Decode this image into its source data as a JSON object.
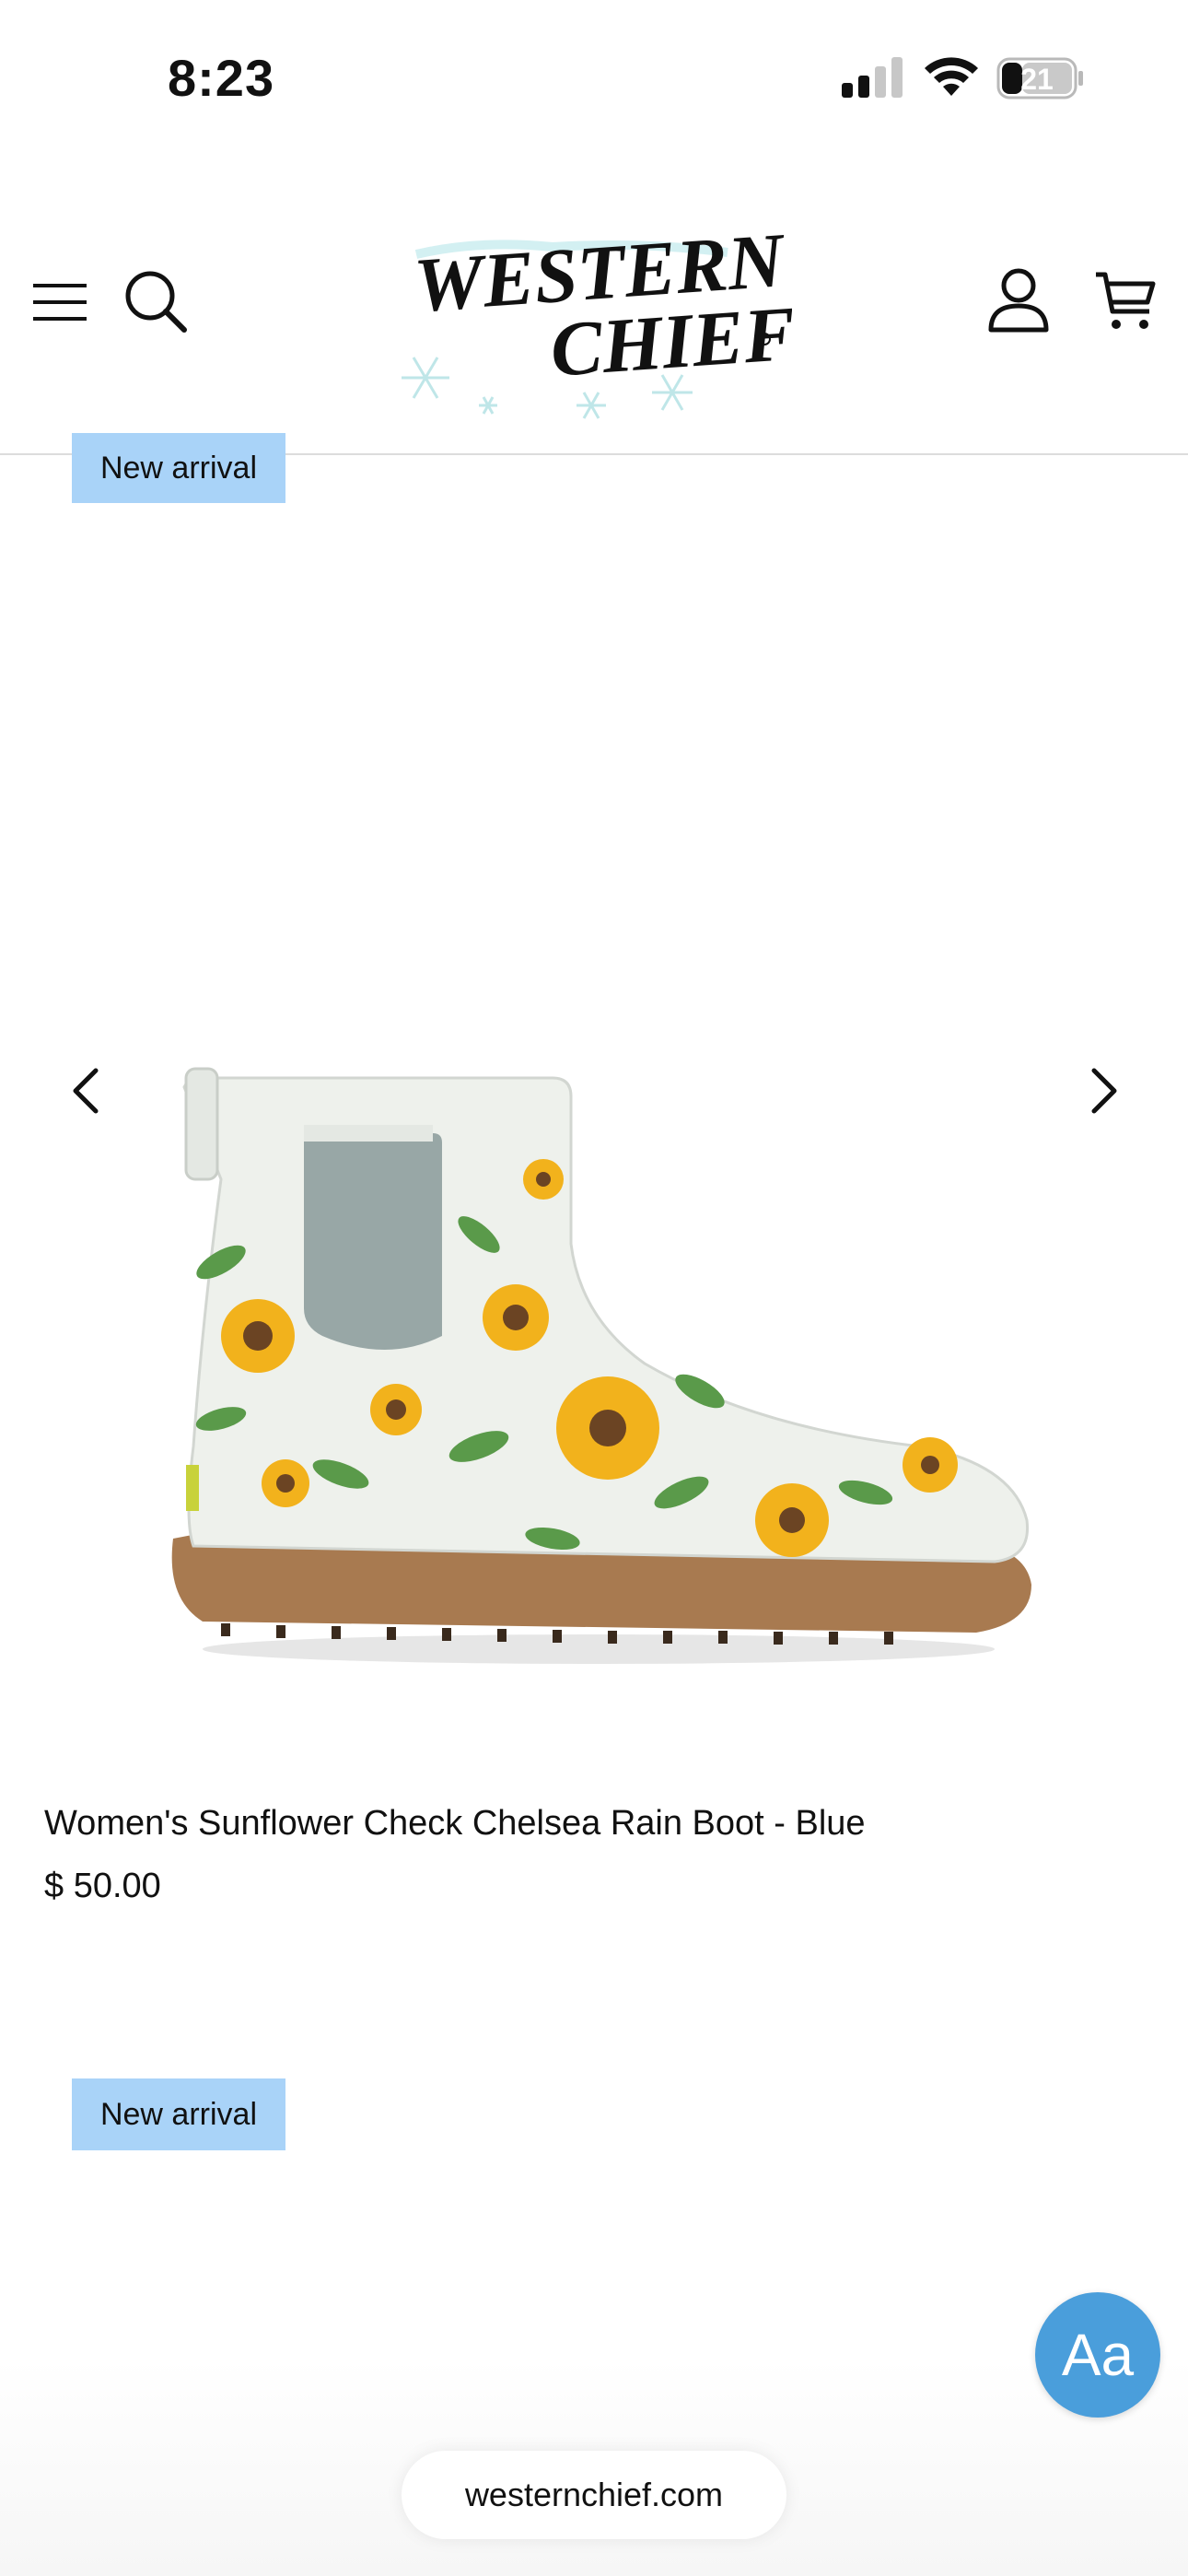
{
  "status_bar": {
    "time": "8:23",
    "battery_level": "21",
    "signal_bars": 2,
    "icons": [
      "signal-icon",
      "wifi-icon",
      "battery-icon"
    ]
  },
  "header": {
    "logo_text_line1": "WESTERN",
    "logo_text_line2": "CHIEF",
    "icons": [
      "menu-icon",
      "search-icon",
      "account-icon",
      "cart-icon"
    ]
  },
  "products": [
    {
      "badge": "New arrival",
      "title": "Women's Sunflower Check Chelsea Rain Boot - Blue",
      "price": "$ 50.00"
    },
    {
      "badge": "New arrival"
    }
  ],
  "carousel": {
    "prev_icon": "chevron-left-icon",
    "next_icon": "chevron-right-icon"
  },
  "accessibility_button": {
    "label": "Aa"
  },
  "browser": {
    "url": "westernchief.com"
  },
  "colors": {
    "badge_bg": "#a9d3f8",
    "aa_button_bg": "#4a9edb",
    "boot_body": "#eef1ec",
    "boot_sole": "#a87a50",
    "boot_elastic": "#98a7a6",
    "sunflower": "#f2b21c"
  }
}
